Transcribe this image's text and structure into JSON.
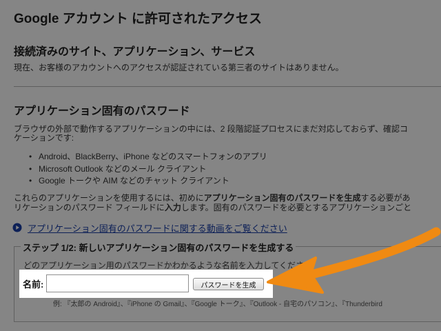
{
  "page": {
    "title": "Google アカウント に許可されたアクセス"
  },
  "connected": {
    "heading": "接続済みのサイト、アプリケーション、サービス",
    "text": "現在、お客様のアカウントへのアクセスが認証されている第三者のサイトはありません。"
  },
  "app_passwords": {
    "heading": "アプリケーション固有のパスワード",
    "intro_line1": "ブラウザの外部で動作するアプリケーションの中には、2 段階認証プロセスにまだ対応しておらず、確認コ",
    "intro_line2": "ケーションです:",
    "bullets": [
      "Android、BlackBerry、iPhone などのスマートフォンのアプリ",
      "Microsoft Outlook などのメール クライアント",
      "Google トークや AIM などのチャット クライアント"
    ],
    "usage_line1_a": "これらのアプリケーションを使用するには、初めに",
    "usage_line1_b": "アプリケーション固有のパスワードを生成",
    "usage_line1_c": "する必要があ",
    "usage_line2_a": "リケーションのパスワード フィールドに",
    "usage_line2_b": "入力",
    "usage_line2_c": "します。固有のパスワードを必要とするアプリケーションごと",
    "video_link": "アプリケーション固有のパスワードに関する動画をご覧ください"
  },
  "step": {
    "legend": "ステップ 1/2: 新しいアプリケーション固有のパスワードを生成する",
    "hint": "どのアプリケーション用のパスワードかわかるような名前を入力してくださ",
    "name_label": "名前:",
    "name_value": "",
    "button_label": "パスワードを生成",
    "examples": "例: 『太郎の Android』、『iPhone の Gmail』、『Google トーク』、『Outlook - 自宅のパソコン』、『Thunderbird"
  },
  "colors": {
    "link": "#1a3fa8",
    "arrow": "#f08a12",
    "overlay": "rgba(0,0,0,0.48)"
  },
  "icons": {
    "video": "play-circle-icon",
    "callout": "arrow-icon"
  }
}
